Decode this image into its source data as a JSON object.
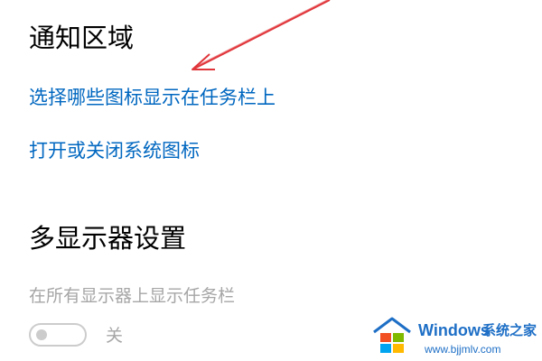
{
  "notification_area": {
    "heading": "通知区域",
    "link_select_icons": "选择哪些图标显示在任务栏上",
    "link_system_icons": "打开或关闭系统图标"
  },
  "multi_display": {
    "heading": "多显示器设置",
    "show_taskbar_label": "在所有显示器上显示任务栏",
    "toggle": {
      "on": false,
      "state_label": "关"
    }
  },
  "annotation": {
    "arrow_color": "#e0353a"
  },
  "watermark": {
    "brand": "Windows",
    "brand_cn": "系统之家",
    "url": "www.bjjmlv.com"
  },
  "colors": {
    "link": "#0067c0",
    "disabled": "#a6a6a6",
    "watermark": "#1e6fc6"
  }
}
